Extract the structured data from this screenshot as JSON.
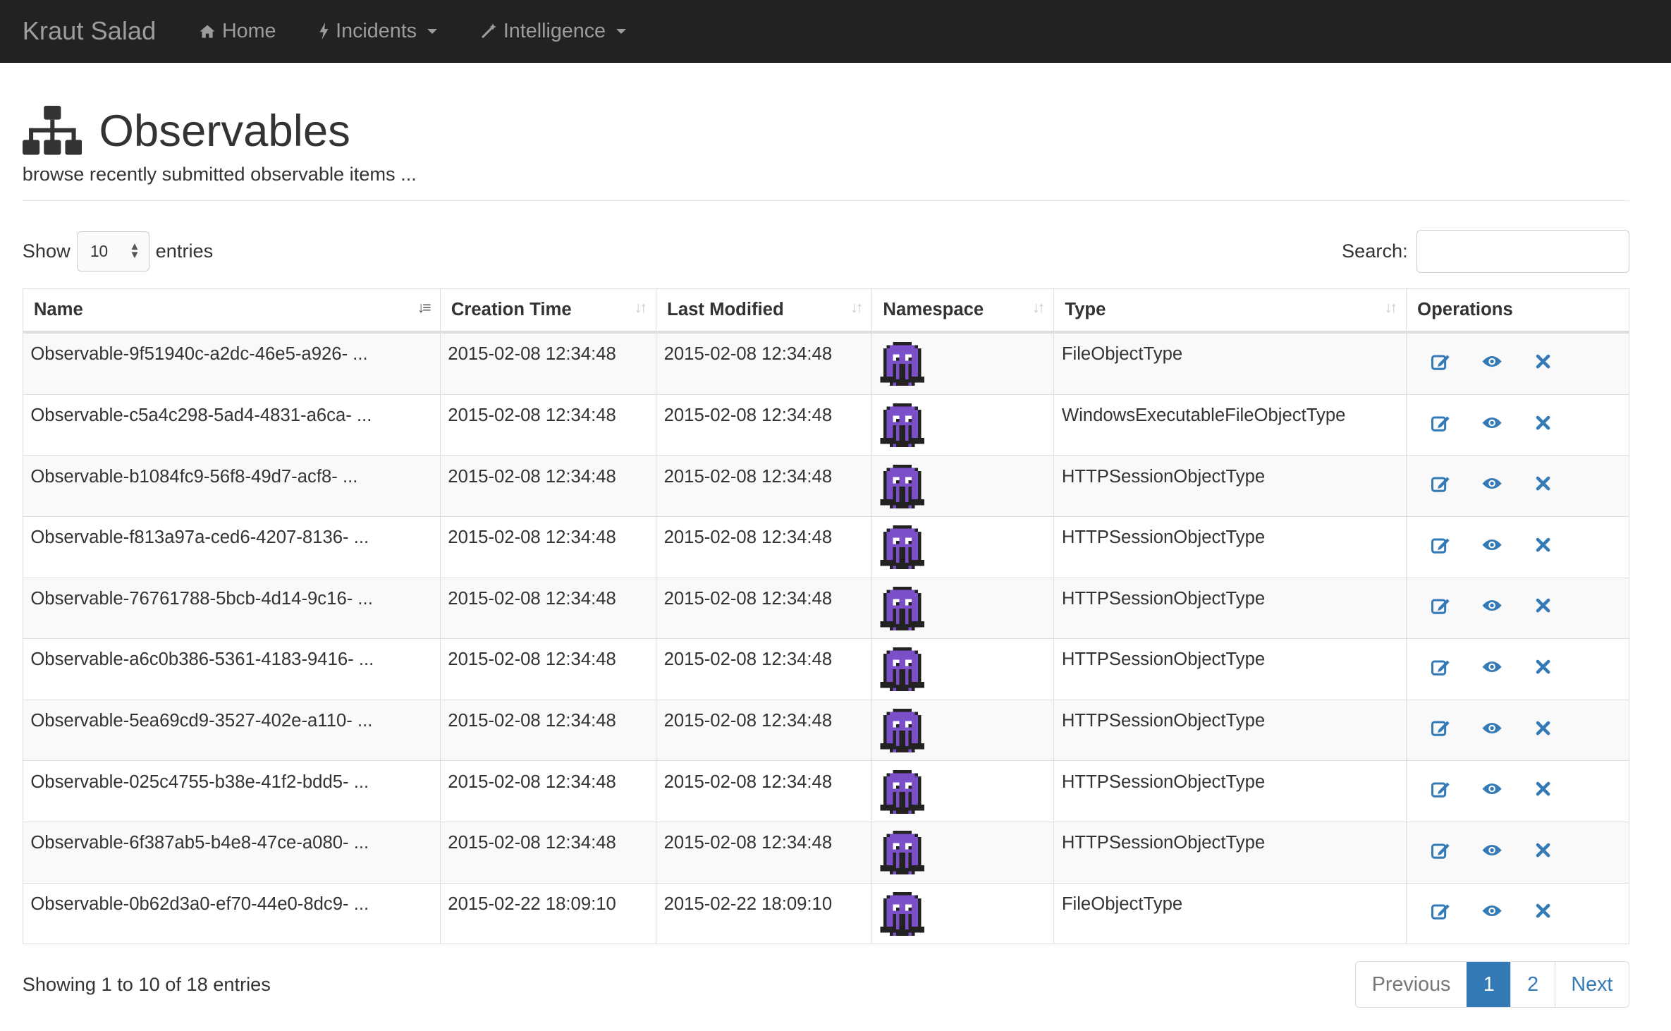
{
  "nav": {
    "brand": "Kraut Salad",
    "items": [
      {
        "label": "Home",
        "icon": "home-icon"
      },
      {
        "label": "Incidents",
        "icon": "bolt-icon"
      },
      {
        "label": "Intelligence",
        "icon": "magic-wand-icon"
      }
    ]
  },
  "header": {
    "title": "Observables",
    "subtitle": "browse recently submitted observable items ...",
    "icon": "sitemap-icon"
  },
  "controls": {
    "show_label": "Show",
    "entries_value": "10",
    "entries_label": "entries",
    "search_label": "Search:",
    "search_value": ""
  },
  "table": {
    "columns": [
      "Name",
      "Creation Time",
      "Last Modified",
      "Namespace",
      "Type",
      "Operations"
    ],
    "rows": [
      {
        "name": "Observable-9f51940c-a2dc-46e5-a926- ...",
        "created": "2015-02-08 12:34:48",
        "modified": "2015-02-08 12:34:48",
        "type": "FileObjectType"
      },
      {
        "name": "Observable-c5a4c298-5ad4-4831-a6ca- ...",
        "created": "2015-02-08 12:34:48",
        "modified": "2015-02-08 12:34:48",
        "type": "WindowsExecutableFileObjectType"
      },
      {
        "name": "Observable-b1084fc9-56f8-49d7-acf8- ...",
        "created": "2015-02-08 12:34:48",
        "modified": "2015-02-08 12:34:48",
        "type": "HTTPSessionObjectType"
      },
      {
        "name": "Observable-f813a97a-ced6-4207-8136- ...",
        "created": "2015-02-08 12:34:48",
        "modified": "2015-02-08 12:34:48",
        "type": "HTTPSessionObjectType"
      },
      {
        "name": "Observable-76761788-5bcb-4d14-9c16- ...",
        "created": "2015-02-08 12:34:48",
        "modified": "2015-02-08 12:34:48",
        "type": "HTTPSessionObjectType"
      },
      {
        "name": "Observable-a6c0b386-5361-4183-9416- ...",
        "created": "2015-02-08 12:34:48",
        "modified": "2015-02-08 12:34:48",
        "type": "HTTPSessionObjectType"
      },
      {
        "name": "Observable-5ea69cd9-3527-402e-a110- ...",
        "created": "2015-02-08 12:34:48",
        "modified": "2015-02-08 12:34:48",
        "type": "HTTPSessionObjectType"
      },
      {
        "name": "Observable-025c4755-b38e-41f2-bdd5- ...",
        "created": "2015-02-08 12:34:48",
        "modified": "2015-02-08 12:34:48",
        "type": "HTTPSessionObjectType"
      },
      {
        "name": "Observable-6f387ab5-b4e8-47ce-a080- ...",
        "created": "2015-02-08 12:34:48",
        "modified": "2015-02-08 12:34:48",
        "type": "HTTPSessionObjectType"
      },
      {
        "name": "Observable-0b62d3a0-ef70-44e0-8dc9- ...",
        "created": "2015-02-22 18:09:10",
        "modified": "2015-02-22 18:09:10",
        "type": "FileObjectType"
      }
    ],
    "namespace_icon": "octopus-avatar-icon",
    "operation_icons": [
      "edit-icon",
      "view-icon",
      "delete-icon"
    ]
  },
  "footer": {
    "info": "Showing 1 to 10 of 18 entries",
    "previous": "Previous",
    "pages": [
      "1",
      "2"
    ],
    "active_page": "1",
    "next": "Next"
  },
  "colors": {
    "navbar_bg": "#222222",
    "link": "#337ab7",
    "avatar": "#7a4fc8"
  }
}
